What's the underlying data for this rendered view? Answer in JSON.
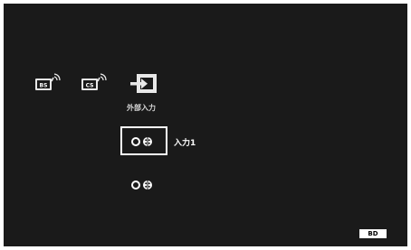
{
  "menu": {
    "broadcast": [
      {
        "label": "BS"
      },
      {
        "label": "CS"
      }
    ],
    "external_input": {
      "label": "外部入力"
    },
    "inputs": [
      {
        "label": "入力1",
        "selected": true
      },
      {
        "label": "",
        "selected": false
      }
    ]
  },
  "footer": {
    "badge": "BD"
  },
  "colors": {
    "background": "#1a1a1a",
    "foreground": "#ffffff"
  },
  "icons": [
    "bs-antenna-icon",
    "cs-antenna-icon",
    "external-input-icon",
    "video-input-icon"
  ]
}
